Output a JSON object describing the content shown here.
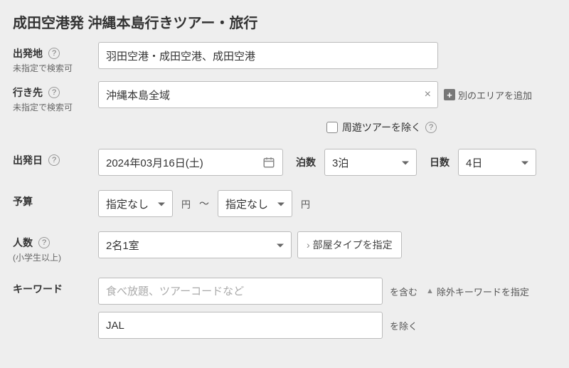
{
  "title": "成田空港発 沖縄本島行きツアー・旅行",
  "departure": {
    "label": "出発地",
    "sub": "未指定で検索可",
    "value": "羽田空港・成田空港、成田空港"
  },
  "destination": {
    "label": "行き先",
    "sub": "未指定で検索可",
    "value": "沖縄本島全域",
    "addArea": "別のエリアを追加"
  },
  "excludeRoundTrip": {
    "label": "周遊ツアーを除く",
    "checked": false
  },
  "departDate": {
    "label": "出発日",
    "value": "2024年03月16日(土)"
  },
  "nights": {
    "label": "泊数",
    "value": "3泊"
  },
  "days": {
    "label": "日数",
    "value": "4日"
  },
  "budget": {
    "label": "予算",
    "min": "指定なし",
    "max": "指定なし",
    "currency": "円",
    "sep": "〜"
  },
  "people": {
    "label": "人数",
    "sub": "(小学生以上)",
    "value": "2名1室",
    "roomTypeBtn": "部屋タイプを指定"
  },
  "keyword": {
    "label": "キーワード",
    "placeholder": "食べ放題、ツアーコードなど",
    "includeSuffix": "を含む",
    "excludeToggle": "除外キーワードを指定",
    "excludeValue": "JAL",
    "excludeSuffix": "を除く"
  }
}
